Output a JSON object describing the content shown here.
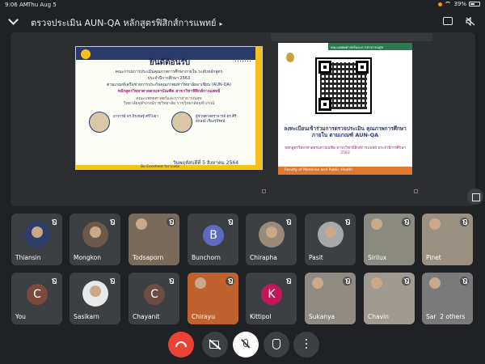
{
  "status_bar": {
    "time": "9:06 AM",
    "date": "Thu Aug 5",
    "battery": "39%"
  },
  "meeting": {
    "title": "ตรวจประเมิน AUN-QA หลักสูตรฟิสิกส์การแพทย์",
    "title_arrow": "▸"
  },
  "slide1": {
    "welcome": "ยินดีต้อนรับ",
    "line1": "คณะกรรมการประเมินคุณภาพการศึกษาภายใน ระดับหลักสูตร",
    "line2": "ประจำปีการศึกษา 2563",
    "line3": "ตามเกณฑ์เครือข่ายการประกันคุณภาพมหาวิทยาลัยอาเซียน (AUN-QA)",
    "line4": "หลักสูตรวิทยาศาสตรมหาบัณฑิต สาขาวิชาฟิสิกส์การแพทย์",
    "line5": "คณะแพทยศาสตร์และการสาธารณสุข",
    "line6": "วิทยาลัยจุฬาภรณ์ราชวิทยาลัย ราชวิทยาลัยจุฬาภรณ์",
    "person1": "อาจารย์ ดร.จิรเชษฐ์ ศรีโบยา",
    "person2": "ผู้ช่วยศาสตราจารย์ ดร.ศิริลักษณ์ เรืองรุจิรัตน์",
    "date": "วันพฤหัสบดีที่ 5 สิงหาคม 2564",
    "footer": "Be Excellent for Lives"
  },
  "slide2": {
    "tab": "คณะแพทยศาสตร์และการสาธารณสุข",
    "register": "ลงทะเบียนเข้าร่วมการตรวจประเมิน คุณภาพการศึกษาภายใน ตามเกณฑ์ AUN-QA",
    "program": "หลักสูตรวิทยาศาสตรมหาบัณฑิต สาขาวิชาฟิสิกส์การแพทย์ ประจำปีการศึกษา 2563",
    "footer": "Faculty of Medicine and Public Health"
  },
  "participants_row1": [
    {
      "name": "Thiansin",
      "type": "photo"
    },
    {
      "name": "Mongkon",
      "type": "photo"
    },
    {
      "name": "Todsaporn",
      "type": "photo"
    },
    {
      "name": "Bunchorn",
      "type": "avatar",
      "initial": "B",
      "color": "#5c6bc0"
    },
    {
      "name": "Chirapha",
      "type": "photo"
    },
    {
      "name": "Pasit",
      "type": "photo"
    },
    {
      "name": "Sirilux",
      "type": "photo"
    },
    {
      "name": "Pinet",
      "type": "photo"
    }
  ],
  "participants_row2": [
    {
      "name": "You",
      "type": "avatar",
      "initial": "C",
      "color": "#7b4a3c"
    },
    {
      "name": "Sasikarn",
      "type": "photo"
    },
    {
      "name": "Chayanit",
      "type": "avatar",
      "initial": "C",
      "color": "#6d4c41"
    },
    {
      "name": "Chirayu",
      "type": "photo"
    },
    {
      "name": "Kittipol",
      "type": "avatar",
      "initial": "K",
      "color": "#c2185b"
    },
    {
      "name": "Sukanya",
      "type": "photo"
    },
    {
      "name": "Chavin",
      "type": "photo"
    },
    {
      "name": "Sar",
      "type": "photo",
      "extra": "2 others"
    }
  ],
  "controls": {
    "end_call": "end-call-icon",
    "camera": "video-off-icon",
    "mic": "mic-off-icon",
    "hand": "hand-icon",
    "more": "more-vert-icon",
    "end_call_color": "#ea4335"
  }
}
